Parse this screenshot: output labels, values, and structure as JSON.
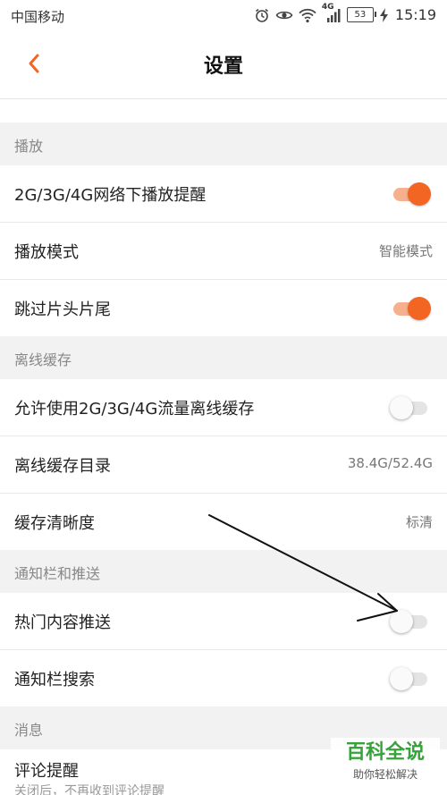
{
  "status_bar": {
    "carrier": "中国移动",
    "network": "4G",
    "battery": "53",
    "time": "15:19"
  },
  "header": {
    "title": "设置",
    "back_icon": "chevron-left-icon"
  },
  "cut_row": {
    "label": ""
  },
  "sections": {
    "play": {
      "title": "播放",
      "mobile_play_alert": {
        "label": "2G/3G/4G网络下播放提醒",
        "enabled": true
      },
      "play_mode": {
        "label": "播放模式",
        "value": "智能模式"
      },
      "skip_intro": {
        "label": "跳过片头片尾",
        "enabled": true
      }
    },
    "offline": {
      "title": "离线缓存",
      "allow_mobile": {
        "label": "允许使用2G/3G/4G流量离线缓存",
        "enabled": false
      },
      "directory": {
        "label": "离线缓存目录",
        "value": "38.4G/52.4G"
      },
      "quality": {
        "label": "缓存清晰度",
        "value": "标清"
      }
    },
    "notify": {
      "title": "通知栏和推送",
      "hot_push": {
        "label": "热门内容推送",
        "enabled": false
      },
      "notify_search": {
        "label": "通知栏搜索",
        "enabled": false
      }
    },
    "messages": {
      "title": "消息",
      "comment_alert": {
        "label": "评论提醒",
        "sub": "关闭后，不再收到评论提醒"
      }
    }
  },
  "watermark": {
    "title": "百科全说",
    "subtitle": "助你轻松解决"
  },
  "colors": {
    "accent": "#f26522",
    "section_bg": "#f2f2f2",
    "watermark_green": "#35a33a"
  }
}
